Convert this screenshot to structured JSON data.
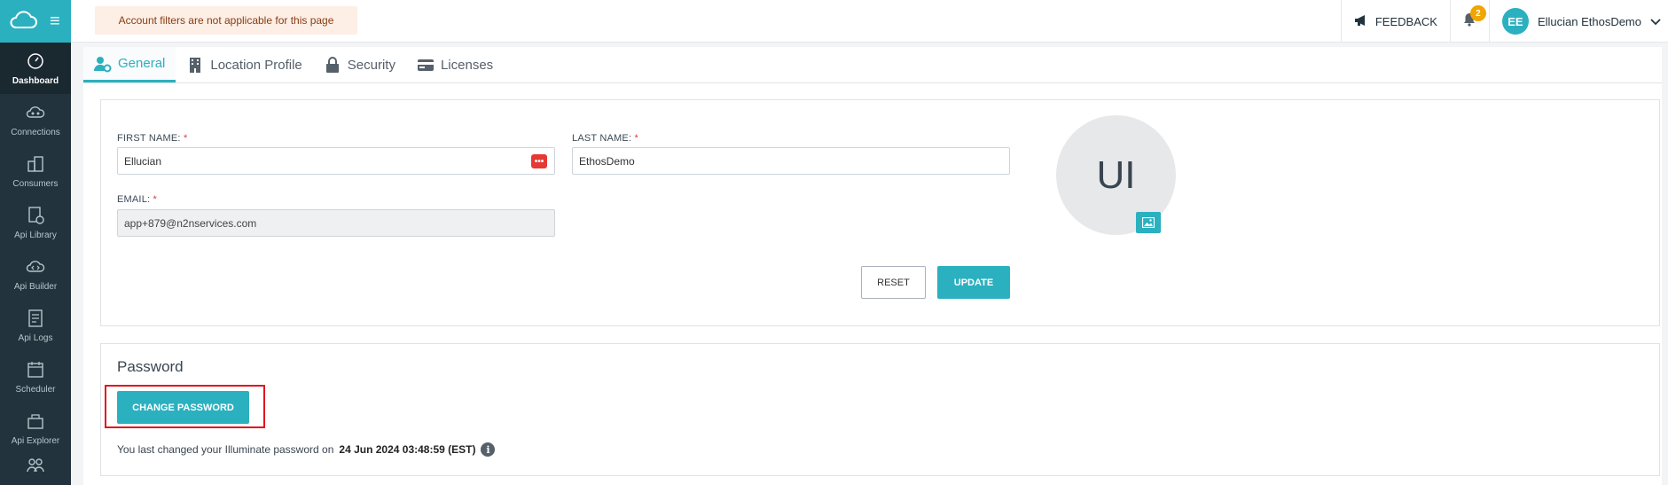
{
  "topbar": {
    "alert_text": "Account filters are not applicable for this page",
    "feedback_label": "FEEDBACK",
    "notification_count": "2",
    "user_initials": "EE",
    "user_name": "Ellucian EthosDemo"
  },
  "sidebar": {
    "items": [
      {
        "label": "Dashboard",
        "icon": "dashboard-icon",
        "active": true
      },
      {
        "label": "Connections",
        "icon": "connections-icon"
      },
      {
        "label": "Consumers",
        "icon": "consumers-icon"
      },
      {
        "label": "Api Library",
        "icon": "api-library-icon"
      },
      {
        "label": "Api Builder",
        "icon": "api-builder-icon"
      },
      {
        "label": "Api Logs",
        "icon": "api-logs-icon"
      },
      {
        "label": "Scheduler",
        "icon": "scheduler-icon"
      },
      {
        "label": "Api Explorer",
        "icon": "api-explorer-icon"
      }
    ]
  },
  "tabs": [
    {
      "label": "General",
      "icon": "user-gear-icon",
      "active": true
    },
    {
      "label": "Location Profile",
      "icon": "building-icon"
    },
    {
      "label": "Security",
      "icon": "lock-icon"
    },
    {
      "label": "Licenses",
      "icon": "card-icon"
    }
  ],
  "profile": {
    "first_name_label": "FIRST NAME:",
    "first_name_value": "Ellucian",
    "last_name_label": "LAST NAME:",
    "last_name_value": "EthosDemo",
    "email_label": "EMAIL:",
    "email_value": "app+879@n2nservices.com",
    "required_mark": "*",
    "avatar_initials": "UI",
    "reset_label": "RESET",
    "update_label": "UPDATE"
  },
  "password": {
    "title": "Password",
    "change_label": "CHANGE PASSWORD",
    "note_prefix": "You last changed your Illuminate password on",
    "note_date": "24 Jun 2024 03:48:59 (EST)"
  },
  "colors": {
    "accent": "#2bb0bf",
    "sidebar": "#22333d",
    "alert_bg": "#fdefe6",
    "highlight": "#e0161e"
  }
}
